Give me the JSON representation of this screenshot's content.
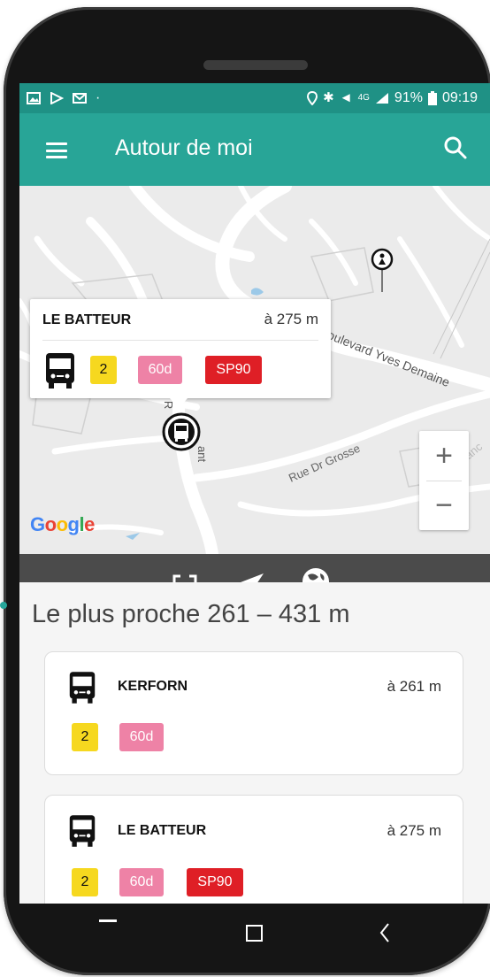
{
  "status_bar": {
    "battery": "91%",
    "time": "09:19",
    "network": "4G"
  },
  "app_bar": {
    "title": "Autour de moi"
  },
  "map": {
    "callout": {
      "stop_name": "LE BATTEUR",
      "distance": "à 275 m",
      "lines": [
        {
          "label": "2",
          "color": "#f6d81f",
          "text_color": "#111111"
        },
        {
          "label": "60d",
          "color": "#ee82a6",
          "text_color": "#ffffff"
        },
        {
          "label": "SP90",
          "color": "#df1f26",
          "text_color": "#ffffff"
        }
      ]
    },
    "street_labels": {
      "boulevard": "oulevard Yves Demaine",
      "rue_grosse": "Rue Dr Grosse",
      "rue_fran": "Rue Franc",
      "rue_vert_1": "e R",
      "rue_vert_2": "ant"
    },
    "attribution": "Google",
    "zoom_in": "+",
    "zoom_out": "−"
  },
  "nearest": {
    "title": "Le plus proche 261 – 431 m",
    "stops": [
      {
        "name": "KERFORN",
        "distance": "à 261 m",
        "lines": [
          {
            "label": "2",
            "color": "#f6d81f",
            "text_color": "#111111"
          },
          {
            "label": "60d",
            "color": "#ee82a6",
            "text_color": "#ffffff"
          }
        ]
      },
      {
        "name": "LE BATTEUR",
        "distance": "à 275 m",
        "lines": [
          {
            "label": "2",
            "color": "#f6d81f",
            "text_color": "#111111"
          },
          {
            "label": "60d",
            "color": "#ee82a6",
            "text_color": "#ffffff"
          },
          {
            "label": "SP90",
            "color": "#df1f26",
            "text_color": "#ffffff"
          }
        ]
      }
    ]
  },
  "colors": {
    "primary": "#28a597",
    "primary_dark": "#1f9185"
  }
}
